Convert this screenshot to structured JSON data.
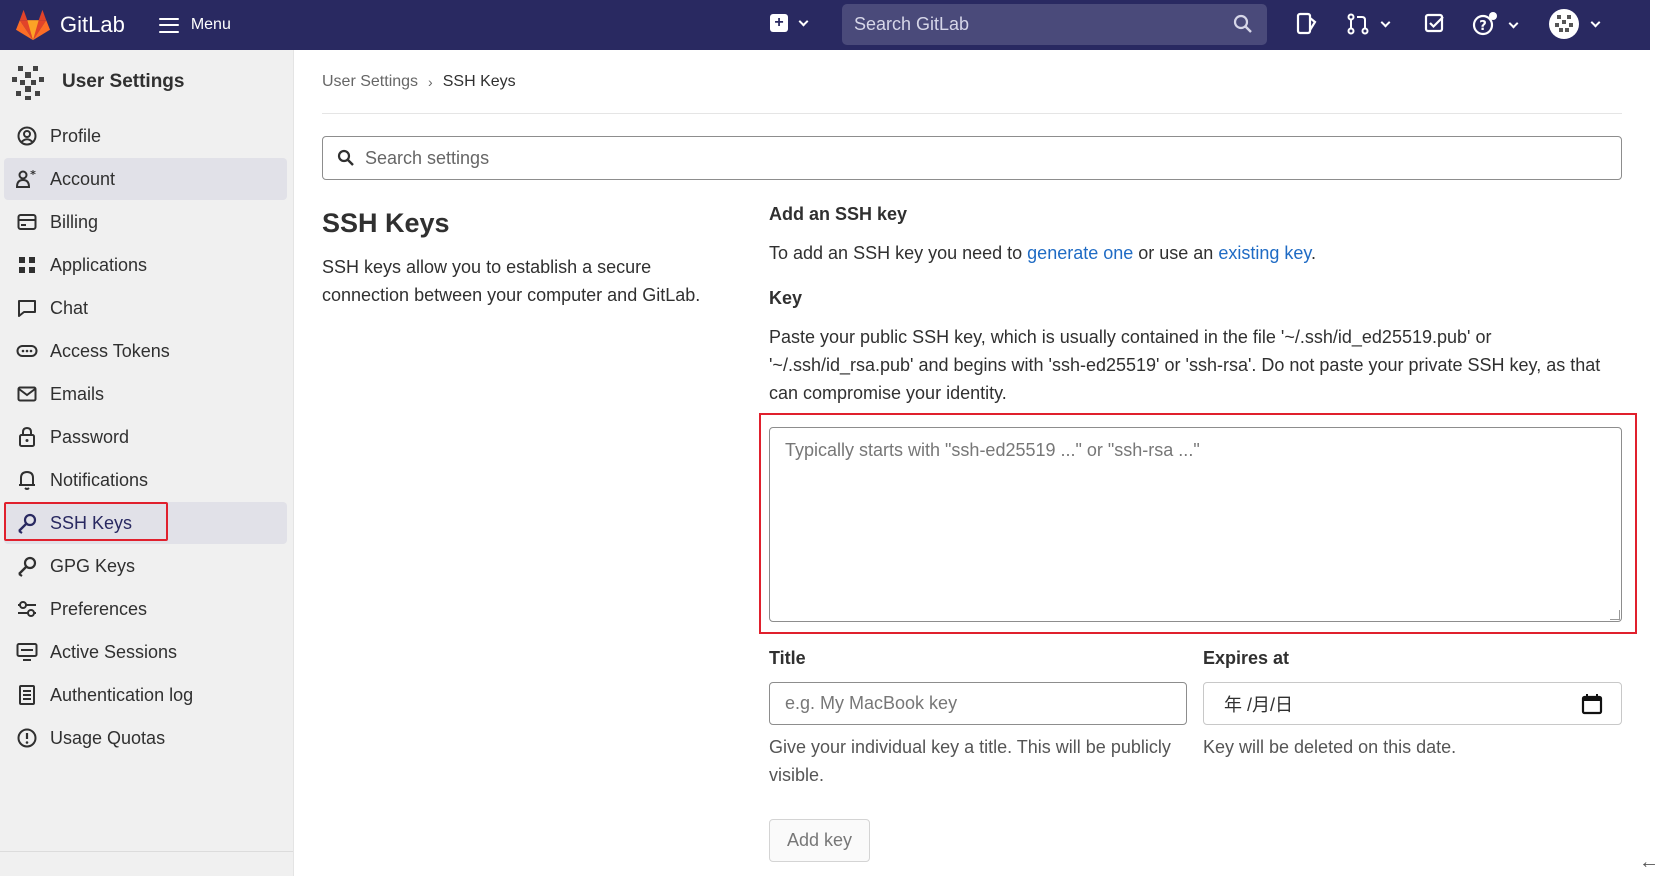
{
  "topbar": {
    "brand": "GitLab",
    "menu_label": "Menu",
    "search_placeholder": "Search GitLab"
  },
  "sidebar": {
    "title": "User Settings",
    "items": [
      {
        "label": "Profile",
        "icon": "profile-icon"
      },
      {
        "label": "Account",
        "icon": "account-icon"
      },
      {
        "label": "Billing",
        "icon": "billing-icon"
      },
      {
        "label": "Applications",
        "icon": "applications-icon"
      },
      {
        "label": "Chat",
        "icon": "chat-icon"
      },
      {
        "label": "Access Tokens",
        "icon": "token-icon"
      },
      {
        "label": "Emails",
        "icon": "mail-icon"
      },
      {
        "label": "Password",
        "icon": "lock-icon"
      },
      {
        "label": "Notifications",
        "icon": "bell-icon"
      },
      {
        "label": "SSH Keys",
        "icon": "key-icon"
      },
      {
        "label": "GPG Keys",
        "icon": "key-icon"
      },
      {
        "label": "Preferences",
        "icon": "preferences-icon"
      },
      {
        "label": "Active Sessions",
        "icon": "monitor-icon"
      },
      {
        "label": "Authentication log",
        "icon": "log-icon"
      },
      {
        "label": "Usage Quotas",
        "icon": "quota-icon"
      }
    ]
  },
  "breadcrumb": {
    "parent": "User Settings",
    "current": "SSH Keys"
  },
  "settings_search": {
    "placeholder": "Search settings"
  },
  "section": {
    "title": "SSH Keys",
    "description": "SSH keys allow you to establish a secure connection between your computer and GitLab."
  },
  "form": {
    "add_heading": "Add an SSH key",
    "intro_before": "To add an SSH key you need to ",
    "intro_link1": "generate one",
    "intro_middle": " or use an ",
    "intro_link2": "existing key",
    "intro_after": ".",
    "key_label": "Key",
    "key_help": "Paste your public SSH key, which is usually contained in the file '~/.ssh/id_ed25519.pub' or '~/.ssh/id_rsa.pub' and begins with 'ssh-ed25519' or 'ssh-rsa'. Do not paste your private SSH key, as that can compromise your identity.",
    "key_placeholder": "Typically starts with \"ssh-ed25519 ...\" or \"ssh-rsa ...\"",
    "title_label": "Title",
    "title_placeholder": "e.g. My MacBook key",
    "title_help": "Give your individual key a title. This will be publicly visible.",
    "expires_label": "Expires at",
    "expires_value": "年 /月/日",
    "expires_help": "Key will be deleted on this date.",
    "submit_label": "Add key"
  },
  "colors": {
    "navbar": "#292961",
    "link": "#1f6bc4",
    "highlight_border": "#e0202d"
  }
}
